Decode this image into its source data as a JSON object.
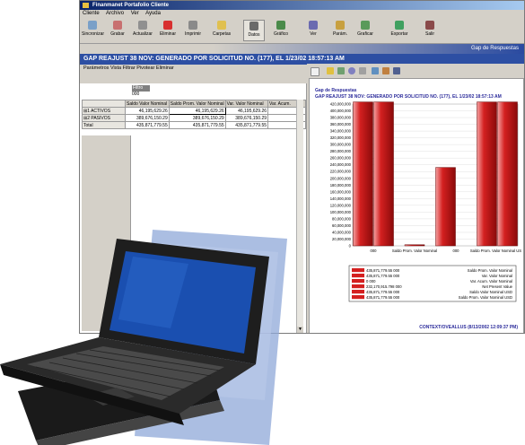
{
  "window": {
    "title": "Finanmanet Portafolio Cliente"
  },
  "menu": [
    "Cliente",
    "Archivo",
    "Ver",
    "Ayuda"
  ],
  "toolbar": [
    {
      "label": "Sincronizar",
      "icon": "sync-icon",
      "color": "#7aa0c8"
    },
    {
      "label": "Grabar",
      "icon": "save-icon",
      "color": "#c87070"
    },
    {
      "label": "Actualizar",
      "icon": "refresh-icon",
      "color": "#909090"
    },
    {
      "label": "Eliminar",
      "icon": "delete-icon",
      "color": "#d83030"
    },
    {
      "label": "Imprimir",
      "icon": "print-icon",
      "color": "#8a8a8a"
    },
    {
      "label": "Carpetas",
      "icon": "folder-icon",
      "color": "#e0c050"
    },
    {
      "label": "Datos",
      "icon": "data-icon",
      "color": "#6a6a6a"
    },
    {
      "label": "Gráfico",
      "icon": "chart-icon",
      "color": "#4a8a4a"
    },
    {
      "label": "Ver",
      "icon": "view-icon",
      "color": "#6a6ab0"
    },
    {
      "label": "Parám.",
      "icon": "params-icon",
      "color": "#c8a040"
    },
    {
      "label": "Graficar",
      "icon": "graph-icon",
      "color": "#5a9a5a"
    },
    {
      "label": "Exportar",
      "icon": "export-icon",
      "color": "#40a060"
    },
    {
      "label": "Salir",
      "icon": "exit-icon",
      "color": "#8a4a4a"
    }
  ],
  "banner": "Gap de Respuestas",
  "header": "GAP REAJUST 38 NOV: GENERADO POR SOLICITUD NO. (177), EL 1/23/02 18:57:13 AM",
  "links": "Parámetros  Vista  Filtrar  Pivotear  Eliminar",
  "selector": {
    "label": "Filtro",
    "value": "000"
  },
  "grid": {
    "columns": [
      "Saldo Valor Nominal",
      "Saldo Prom. Valor Nominal",
      "Var. Valor Nominal",
      "Var. Acum."
    ],
    "rows": [
      {
        "label": "⊞1 ACTIVOS",
        "values": [
          "46,195,629.26",
          "46,195,629.26",
          "46,195,629.26",
          ""
        ]
      },
      {
        "label": "⊞2 PASIVOS",
        "values": [
          "389,676,150.29",
          "389,676,150.29",
          "389,676,150.29",
          ""
        ]
      },
      {
        "label": "Total",
        "values": [
          "435,871,779.55",
          "435,871,779.55",
          "435,871,779.55",
          ""
        ]
      }
    ]
  },
  "chart_panel": {
    "title": "Gap de Respuestas",
    "subtitle": "GAP REAJUST 38 NOV: GENERADO POR SOLICITUD NO. (177), EL 1/23/02 18:57:13 AM",
    "footer": "CONTEXT/OVEALLUS (8/13/2002 12:09:37 PM)"
  },
  "chart_data": {
    "type": "bar",
    "categories": [
      "000",
      "Saldo Prom. Valor Nominal",
      "000",
      "Saldo Prom. Valor Nominal USD"
    ],
    "ylim": [
      0,
      420000000
    ],
    "yticks": [
      "420,000,000",
      "400,000,000",
      "380,000,000",
      "360,000,000",
      "340,000,000",
      "320,000,000",
      "300,000,000",
      "280,000,000",
      "260,000,000",
      "240,000,000",
      "220,000,000",
      "200,000,000",
      "180,000,000",
      "160,000,000",
      "140,000,000",
      "120,000,000",
      "100,000,000",
      "80,000,000",
      "60,000,000",
      "40,000,000",
      "20,000,000",
      "0"
    ],
    "series": [
      {
        "name": "Saldo Prom. Valor Nominal",
        "value": 435871779.55
      },
      {
        "name": "Var. Valor Nominal",
        "value": 435871779.55
      },
      {
        "name": "Var. Acum. Valor Nominal",
        "value": 0
      },
      {
        "name": "Net Present Value",
        "value": 232170915.798
      },
      {
        "name": "Saldo Valor Nominal USD",
        "value": 435871779.55
      },
      {
        "name": "Saldo Prom. Valor Nominal USD",
        "value": 435871779.55
      }
    ],
    "legend": [
      {
        "value": "435,871,779.55 000",
        "name": "Saldo Prom. Valor Nominal"
      },
      {
        "value": "435,871,779.55 000",
        "name": "Var. Valor Nominal"
      },
      {
        "value": "0 000",
        "name": "Var. Acum. Valor Nominal"
      },
      {
        "value": "232,170,915.798 000",
        "name": "Net Present Value"
      },
      {
        "value": "435,871,779.55 000",
        "name": "Saldo Valor Nominal USD"
      },
      {
        "value": "435,871,779.55 000",
        "name": "Saldo Prom. Valor Nominal USD"
      }
    ],
    "bar_color": "#d42020",
    "legend_position": "bottom"
  }
}
